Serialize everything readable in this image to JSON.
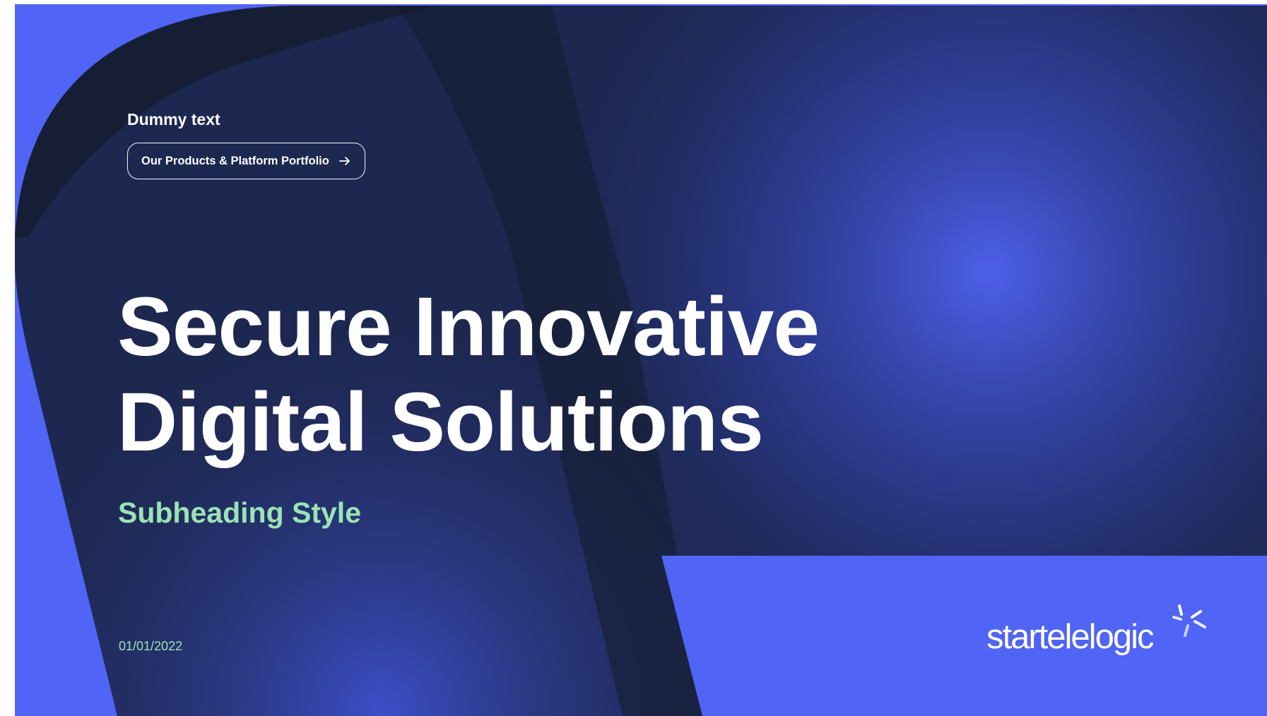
{
  "slide": {
    "eyebrow": "Dummy text",
    "cta_label": "Our Products & Platform Portfolio",
    "title_line1": "Secure Innovative",
    "title_line2": "Digital Solutions",
    "subheading": "Subheading Style",
    "date": "01/01/2022",
    "logo_text": "startelelogic"
  },
  "icons": {
    "cta_icon": "arrow-right-icon",
    "logo_mark": "starburst-icon"
  },
  "colors": {
    "background_blue": "#5064f5",
    "dark_navy": "#141c2e",
    "accent_green": "#9be3b4",
    "text_white": "#ffffff"
  }
}
